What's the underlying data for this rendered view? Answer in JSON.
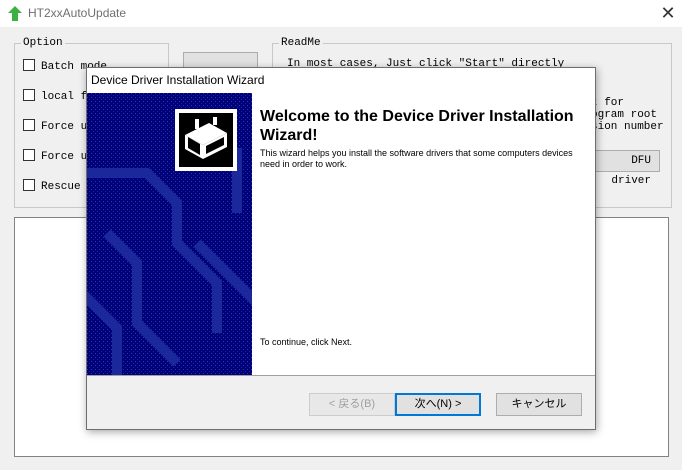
{
  "window": {
    "title": "HT2xxAutoUpdate",
    "close_glyph": "✕",
    "icon": "green-up-arrow-icon"
  },
  "option_group": {
    "legend": "Option",
    "items": [
      {
        "label": "Batch mode"
      },
      {
        "label": "local fi"
      },
      {
        "label": "Force up"
      },
      {
        "label": "Force up"
      },
      {
        "label": "Rescue"
      }
    ]
  },
  "readme_group": {
    "legend": "ReadMe",
    "line1": "In most cases, Just click \"Start\" directly",
    "frag1": "t for",
    "frag2": "ogram root",
    "frag3": "sion number"
  },
  "dfu_button": {
    "label": "DFU driver"
  },
  "wizard": {
    "title": "Device Driver Installation Wizard",
    "heading": "Welcome to the Device Driver Installation Wizard!",
    "description": "This wizard helps you install the software drivers that some computers devices need in order to work.",
    "continue_text": "To continue, click Next.",
    "back_label": "< 戻る(B)",
    "next_label": "次へ(N) >",
    "cancel_label": "キャンセル",
    "banner_color": "#000080",
    "banner_icon": "hardware-device-icon"
  }
}
